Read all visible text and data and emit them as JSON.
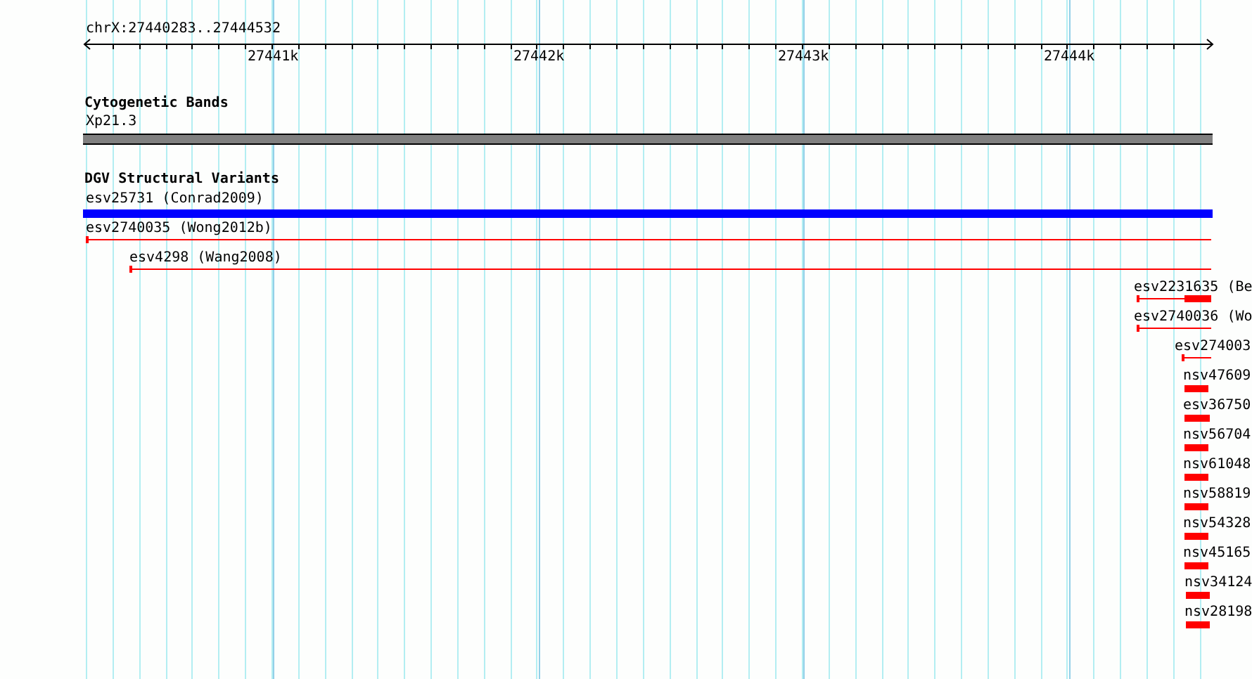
{
  "ruler": {
    "range": "chrX:27440283..27444532",
    "ticks": [
      "27441k",
      "27442k",
      "27443k",
      "27444k"
    ]
  },
  "tracks": [
    {
      "title": "Cytogenetic Bands",
      "features": [
        {
          "label": "Xp21.3",
          "kind": "band",
          "color": "#808080"
        }
      ]
    },
    {
      "title": "DGV Structural Variants",
      "features": [
        {
          "label": "esv25731 (Conrad2009)",
          "kind": "bar",
          "color": "#0000ff"
        },
        {
          "label": "esv2740035 (Wong2012b)",
          "kind": "line",
          "color": "#ff0000"
        },
        {
          "label": "esv4298 (Wang2008)",
          "kind": "line",
          "color": "#ff0000"
        },
        {
          "label": "esv2231635 (Be",
          "kind": "split",
          "color": "#ff0000"
        },
        {
          "label": "esv2740036 (Wo",
          "kind": "line",
          "color": "#ff0000"
        },
        {
          "label": "esv274003",
          "kind": "line",
          "color": "#ff0000"
        },
        {
          "label": "nsv47609",
          "kind": "bar",
          "color": "#ff0000"
        },
        {
          "label": "esv36750",
          "kind": "bar",
          "color": "#ff0000"
        },
        {
          "label": "nsv56704",
          "kind": "bar",
          "color": "#ff0000"
        },
        {
          "label": "nsv61048",
          "kind": "bar",
          "color": "#ff0000"
        },
        {
          "label": "nsv58819",
          "kind": "bar",
          "color": "#ff0000"
        },
        {
          "label": "nsv54328",
          "kind": "bar",
          "color": "#ff0000"
        },
        {
          "label": "nsv45165",
          "kind": "bar",
          "color": "#ff0000"
        },
        {
          "label": "nsv34124",
          "kind": "bar",
          "color": "#ff0000"
        },
        {
          "label": "nsv28198",
          "kind": "bar",
          "color": "#ff0000"
        }
      ]
    }
  ]
}
